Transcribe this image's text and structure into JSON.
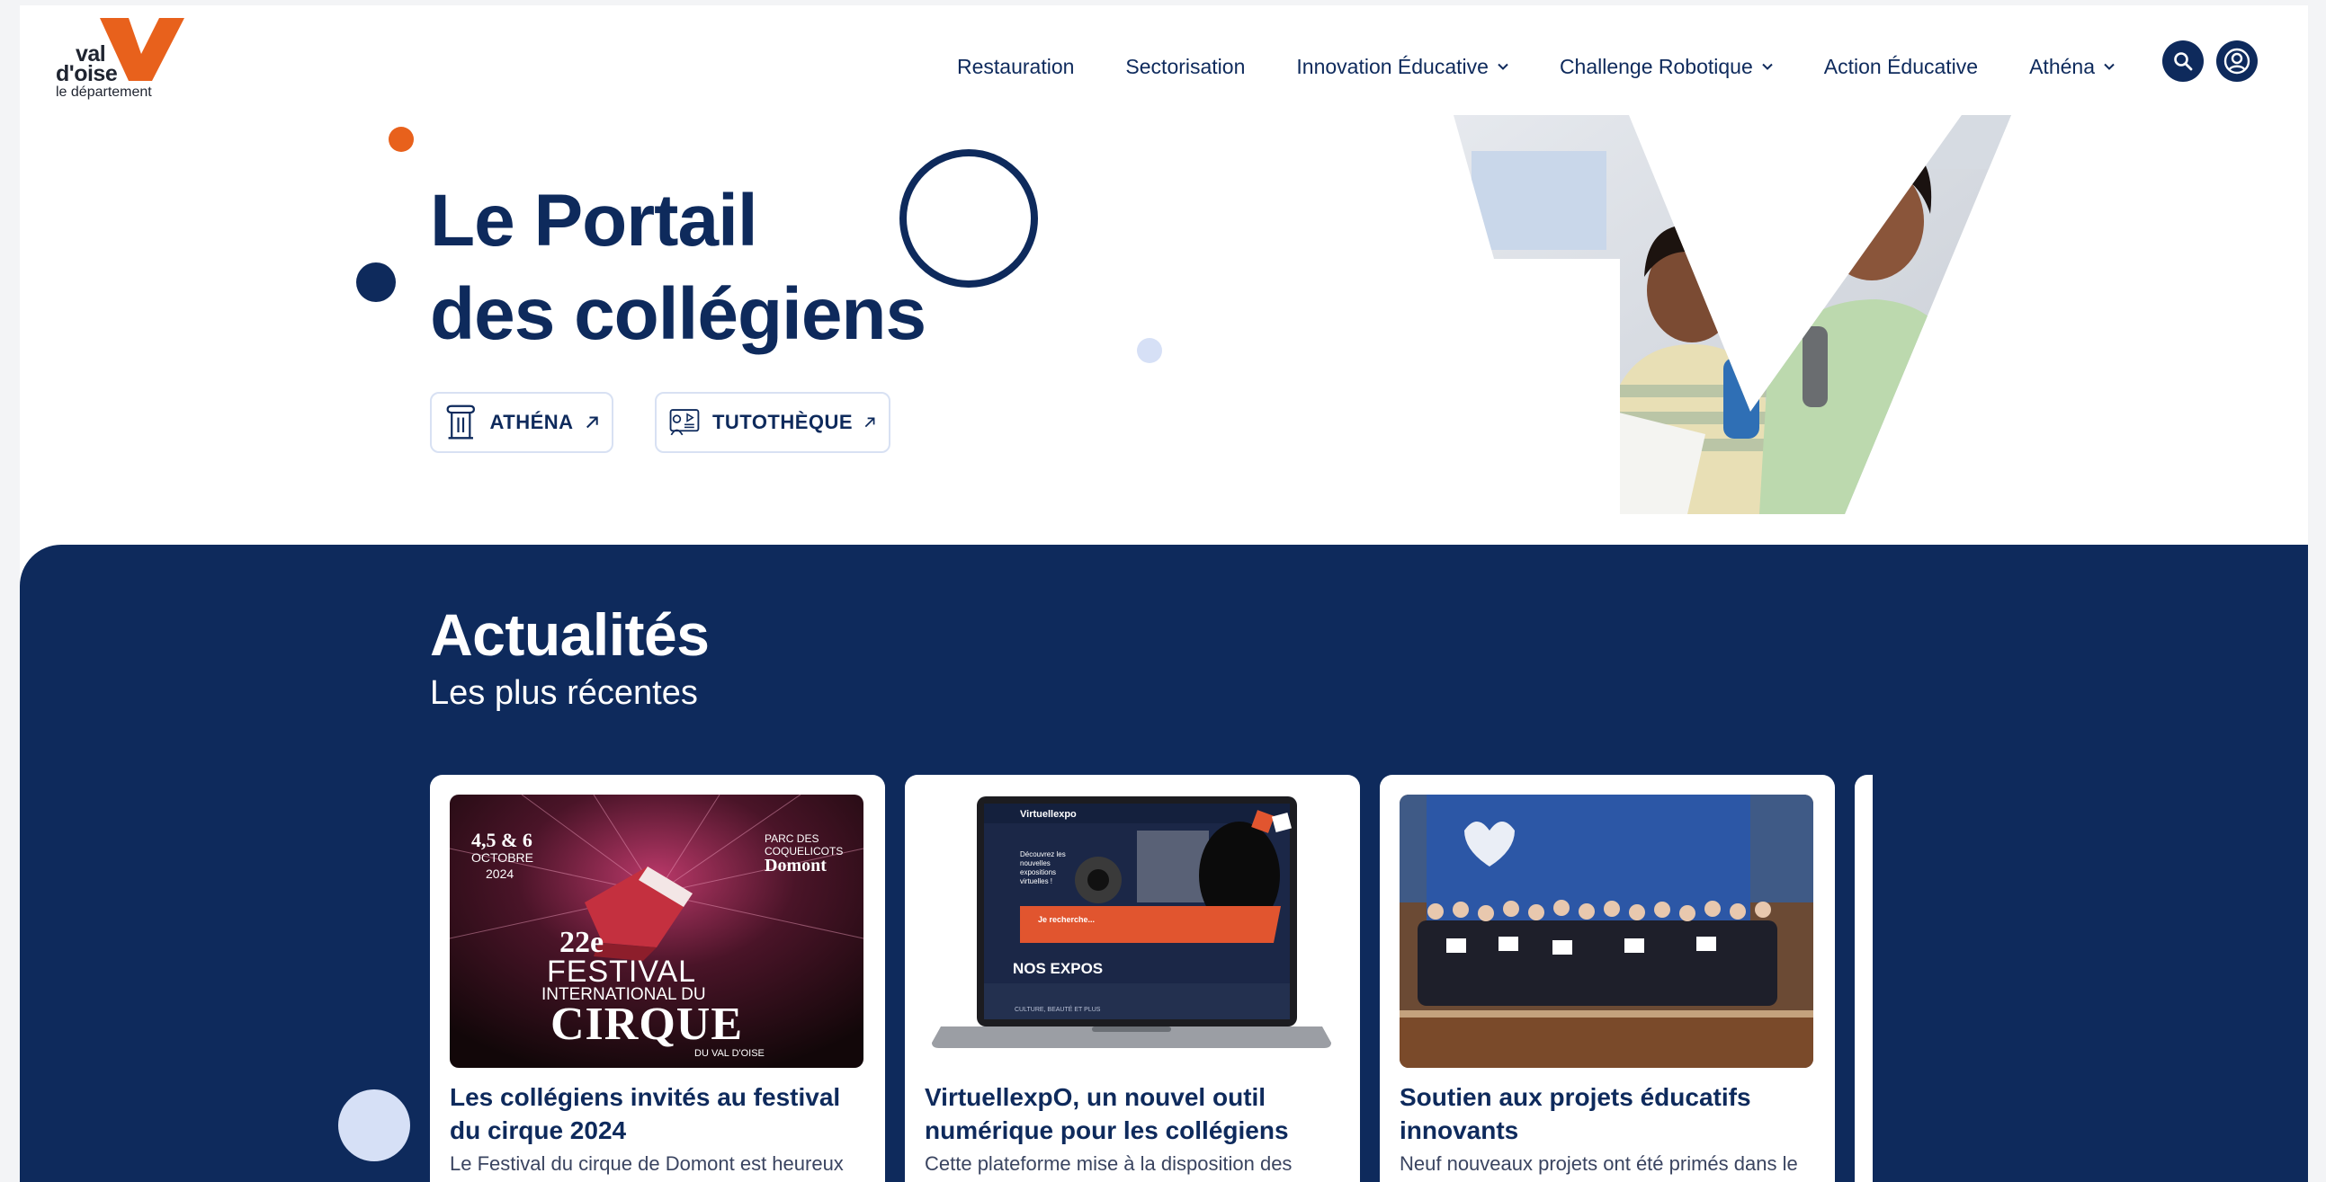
{
  "logo": {
    "line1": "val",
    "line2": "d'oise",
    "line3": "le département",
    "accent": "#e8611c"
  },
  "nav": {
    "items": [
      {
        "label": "Restauration",
        "has_dropdown": false
      },
      {
        "label": "Sectorisation",
        "has_dropdown": false
      },
      {
        "label": "Innovation Éducative",
        "has_dropdown": true
      },
      {
        "label": "Challenge Robotique",
        "has_dropdown": true
      },
      {
        "label": "Action Éducative",
        "has_dropdown": false
      },
      {
        "label": "Athéna",
        "has_dropdown": true
      }
    ],
    "search_icon": "search-icon",
    "account_icon": "user-circle-icon"
  },
  "hero": {
    "title_line1": "Le Portail",
    "title_line2": "des collégiens",
    "buttons": [
      {
        "label": "ATHÉNA",
        "icon": "column-icon"
      },
      {
        "label": "TUTOTHÈQUE",
        "icon": "tutorial-icon"
      }
    ]
  },
  "news": {
    "title": "Actualités",
    "subtitle": "Les plus récentes",
    "cards": [
      {
        "title": "Les collégiens invités au festival du cirque 2024",
        "excerpt": "Le Festival du cirque de Domont est heureux",
        "poster": {
          "dates": "4,5 & 6",
          "month": "OCTOBRE",
          "year": "2024",
          "place_line1": "PARC DES",
          "place_line2": "COQUELICOTS",
          "place_line3": "Domont",
          "edition": "22e",
          "line_a": "FESTIVAL",
          "line_b": "INTERNATIONAL DU",
          "line_c": "CIRQUE",
          "line_d": "DU VAL D'OISE"
        }
      },
      {
        "title": "VirtuellexpO, un nouvel outil numérique pour les collégiens",
        "excerpt": "Cette plateforme mise à la disposition des",
        "screen": {
          "brand": "Virtuellexpo",
          "tagline": "Découvrez les nouvelles expositions virtuelles !",
          "search": "Je recherche...",
          "section": "NOS EXPOS",
          "footer": "CULTURE, BEAUTÉ ET PLUS"
        }
      },
      {
        "title": "Soutien aux projets éducatifs innovants",
        "excerpt": "Neuf nouveaux projets ont été primés dans le"
      }
    ]
  },
  "colors": {
    "navy": "#0e2a5c",
    "orange": "#e8611c",
    "light_blue": "#d6e0f6"
  }
}
